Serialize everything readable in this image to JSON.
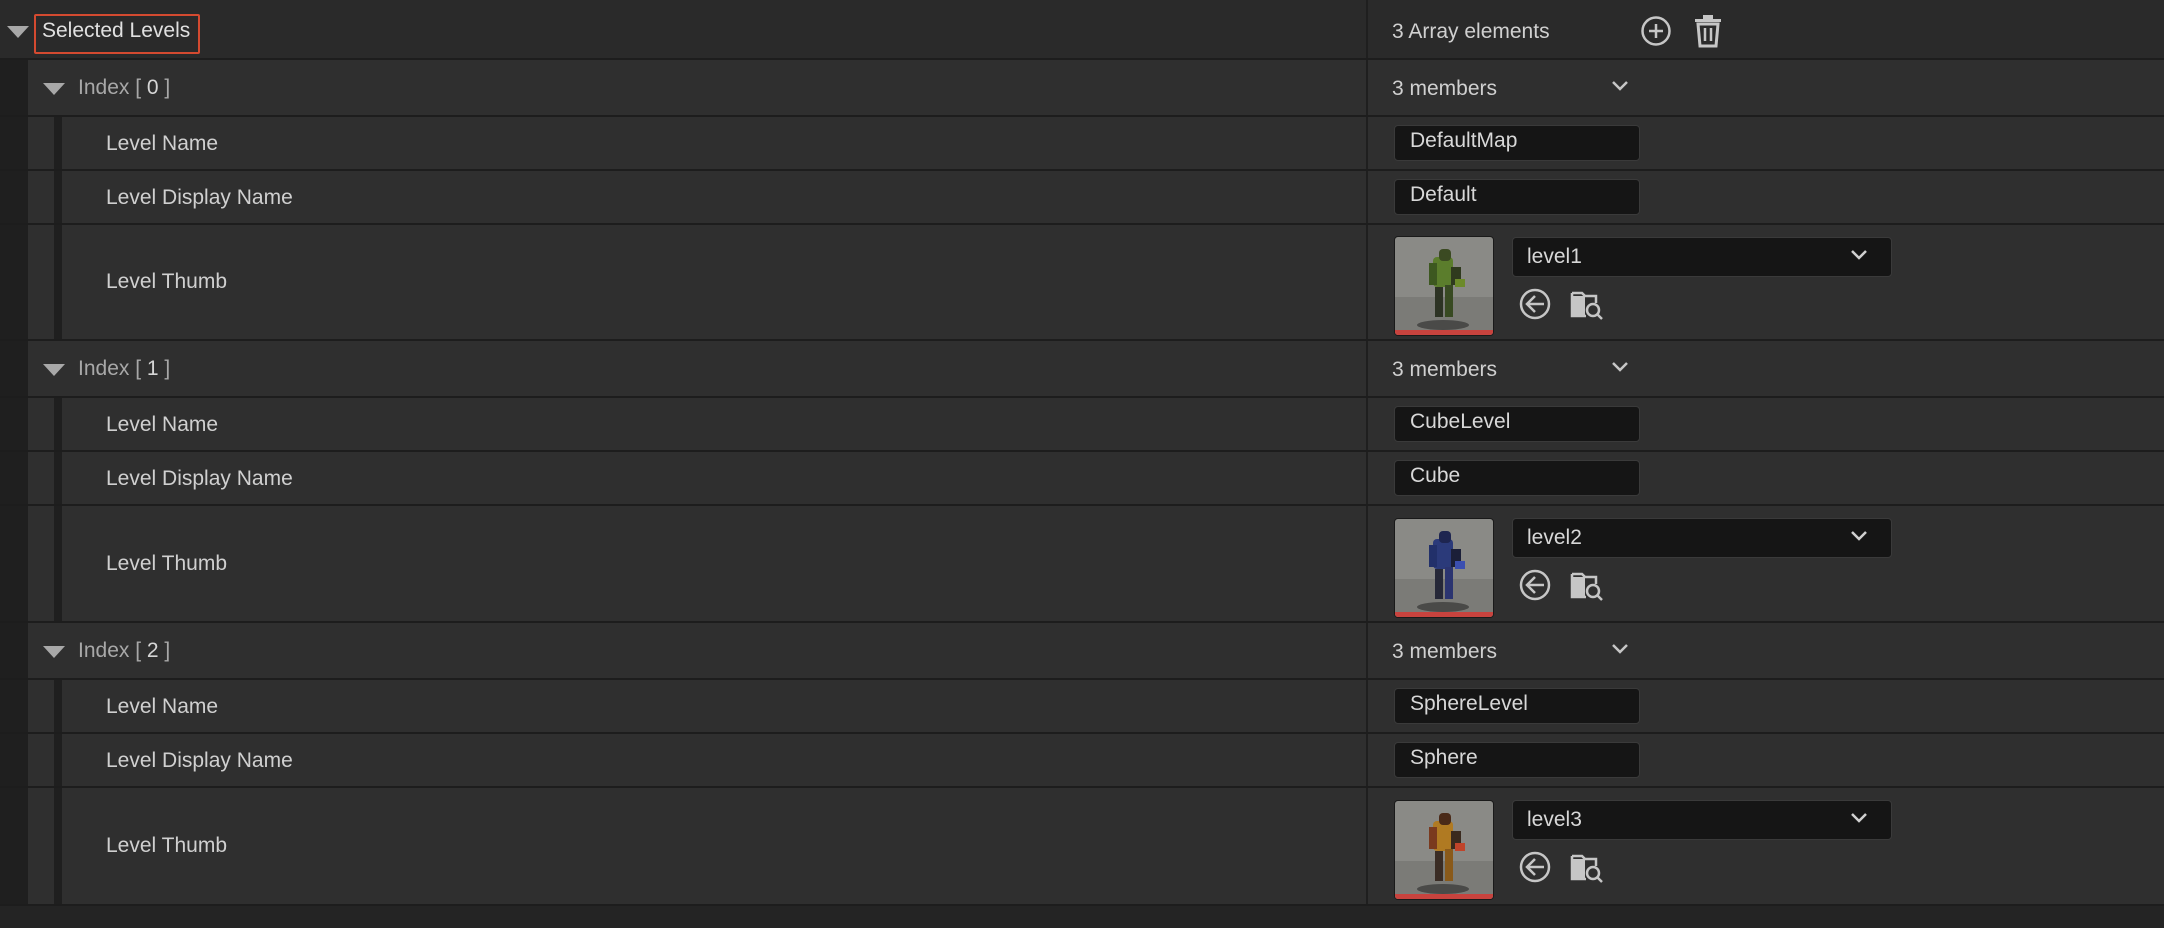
{
  "array": {
    "label": "Selected Levels",
    "summary": "3 Array elements",
    "add_icon": "add-circle-icon",
    "delete_icon": "trash-icon"
  },
  "entries": [
    {
      "index_label": "Index",
      "index_value": "0",
      "members": "3 members",
      "level_name_label": "Level Name",
      "level_name": "DefaultMap",
      "display_name_label": "Level Display Name",
      "display_name": "Default",
      "thumb_label": "Level Thumb",
      "thumb_asset": "level1"
    },
    {
      "index_label": "Index",
      "index_value": "1",
      "members": "3 members",
      "level_name_label": "Level Name",
      "level_name": "CubeLevel",
      "display_name_label": "Level Display Name",
      "display_name": "Cube",
      "thumb_label": "Level Thumb",
      "thumb_asset": "level2"
    },
    {
      "index_label": "Index",
      "index_value": "2",
      "members": "3 members",
      "level_name_label": "Level Name",
      "level_name": "SphereLevel",
      "display_name_label": "Level Display Name",
      "display_name": "Sphere",
      "thumb_label": "Level Thumb",
      "thumb_asset": "level3"
    }
  ],
  "colors": {
    "highlight": "#d44a30",
    "thumb_bar": "#c8433e"
  }
}
